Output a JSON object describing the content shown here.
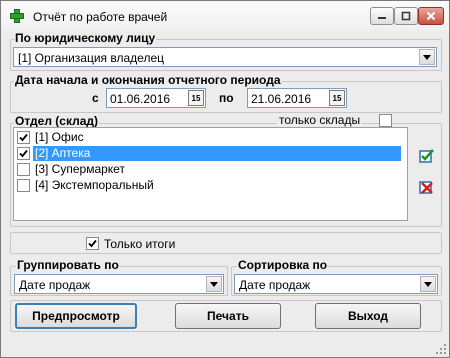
{
  "window": {
    "title": "Отчёт по работе врачей",
    "icon": "green-cross-icon"
  },
  "legal_entity": {
    "label": "По юридическому лицу",
    "selected": "[1] Организация владелец"
  },
  "period": {
    "label": "Дата начала и окончания отчетного периода",
    "from_label": "с",
    "from_value": "01.06.2016",
    "to_label": "по",
    "to_value": "21.06.2016",
    "calendar_glyph": "15"
  },
  "departments": {
    "label": "Отдел (склад)",
    "only_warehouses_label": "только склады",
    "only_warehouses_checked": false,
    "items": [
      {
        "label": "[1] Офис",
        "checked": true,
        "selected": false
      },
      {
        "label": "[2] Аптека",
        "checked": true,
        "selected": true
      },
      {
        "label": "[3] Супермаркет",
        "checked": false,
        "selected": false
      },
      {
        "label": "[4] Экстемпоральный",
        "checked": false,
        "selected": false
      }
    ]
  },
  "totals_only": {
    "label": "Только итоги",
    "checked": true
  },
  "group_by": {
    "label": "Группировать по",
    "selected": "Дате продаж"
  },
  "sort_by": {
    "label": "Сортировка по",
    "selected": "Дате продаж"
  },
  "buttons": {
    "preview": "Предпросмотр",
    "print": "Печать",
    "exit": "Выход"
  }
}
